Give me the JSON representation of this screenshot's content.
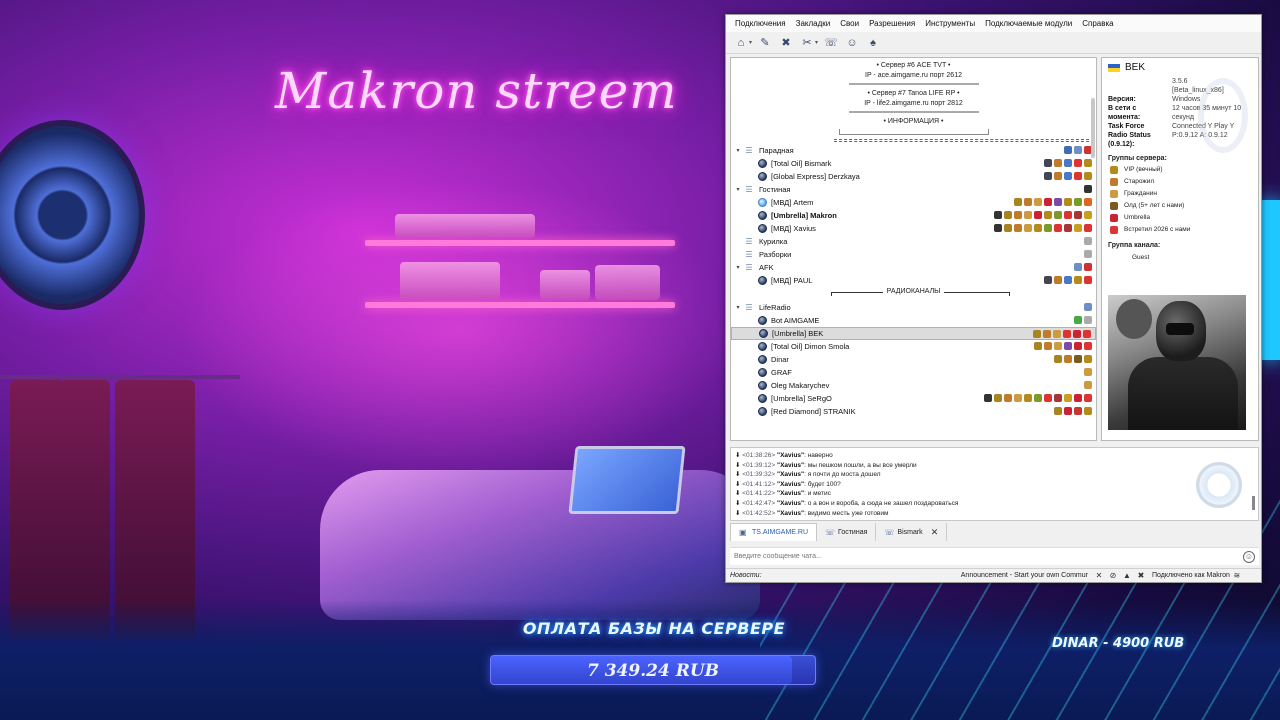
{
  "overlay": {
    "neon_sign": "Makron streem",
    "donate_title": "ОПЛАТА БАЗЫ НА СЕРВЕРЕ",
    "donate_amount": "7 349.24 RUB",
    "donate_progress": 0.93,
    "dinar_label": "DINAR - 4900 RUB"
  },
  "window": {
    "menu": [
      "Подключения",
      "Закладки",
      "Свои",
      "Разрешения",
      "Инструменты",
      "Подключаемые модули",
      "Справка"
    ],
    "toolbar": [
      {
        "icon": "connect-icon"
      },
      {
        "icon": "bookmark-icon"
      },
      {
        "icon": "away-icon"
      },
      {
        "icon": "mute-icon"
      },
      {
        "icon": "chat-icon"
      },
      {
        "icon": "contacts-icon"
      },
      {
        "icon": "whisper-icon"
      }
    ]
  },
  "tree": {
    "banner": {
      "server6": "• Сервер #6 ACE TVT •",
      "server6_ip": "IP - ace.aimgame.ru порт 2612",
      "server7": "• Сервер #7 Tanoa LIFE RP •",
      "server7_ip": "IP - life2.aimgame.ru порт 2812",
      "info": "• ИНФОРМАЦИЯ •"
    },
    "radio_separator": "РАДИОКАНАЛЫ",
    "rows": [
      {
        "type": "channel",
        "caret": "▾",
        "name": "Парадная",
        "badges": [
          "#3f6db3",
          "#6e8fc4",
          "#c33"
        ]
      },
      {
        "type": "client",
        "name": "[Total Oil] Bismark",
        "badges": [
          "#445",
          "#c07a2a",
          "#4a78c8",
          "#d33",
          "#b58a1c"
        ]
      },
      {
        "type": "client",
        "name": "[Global Express] Derzkaya",
        "badges": [
          "#445",
          "#c07a2a",
          "#4a78c8",
          "#d33",
          "#b58a1c"
        ]
      },
      {
        "type": "channel",
        "caret": "▾",
        "name": "Гостиная",
        "badges": [
          "#333"
        ]
      },
      {
        "type": "client",
        "talk": true,
        "name": "[МВД] Artem",
        "badges": [
          "#a88420",
          "#c07a2a",
          "#cc9a40",
          "#c23",
          "#7b4aa8",
          "#b58a1c",
          "#7a9a2a",
          "#d62"
        ]
      },
      {
        "type": "client",
        "bold": true,
        "name": "[Umbrella] Makron",
        "badges": [
          "#333",
          "#a88420",
          "#c07a2a",
          "#cc9a40",
          "#c23",
          "#b58a1c",
          "#7a9a2a",
          "#d33",
          "#a33",
          "#c8a020"
        ]
      },
      {
        "type": "client",
        "name": "[МВД] Xavius",
        "badges": [
          "#333",
          "#a88420",
          "#c07a2a",
          "#cc9a40",
          "#b58a1c",
          "#7a9a2a",
          "#d33",
          "#a33",
          "#c8a020",
          "#d33"
        ]
      },
      {
        "type": "channel",
        "caret": "",
        "name": "Курилка",
        "badges": [
          "#aaa"
        ]
      },
      {
        "type": "channel",
        "caret": "",
        "name": "Разборки",
        "badges": [
          "#aaa"
        ]
      },
      {
        "type": "channel",
        "caret": "▾",
        "name": "AFK",
        "badges": [
          "#6e8fc4",
          "#c33"
        ]
      },
      {
        "type": "client",
        "name": "[МВД] PAUL",
        "badges": [
          "#445",
          "#c07a2a",
          "#4a78c8",
          "#b58a1c",
          "#d33"
        ]
      },
      {
        "type": "separator"
      },
      {
        "type": "channel",
        "caret": "▾",
        "name": "LifeRadio",
        "badges": [
          "#6e8fc4"
        ]
      },
      {
        "type": "client",
        "name": "Bot AIMGAME",
        "badges": [
          "#4a4",
          "#aaa"
        ]
      },
      {
        "type": "client",
        "selected": true,
        "name": "[Umbrella] BEK",
        "badges": [
          "#a88420",
          "#c07a2a",
          "#cc9a40",
          "#d33",
          "#c23",
          "#d33"
        ]
      },
      {
        "type": "client",
        "name": "[Total Oil] Dimon Smola",
        "badges": [
          "#a88420",
          "#c07a2a",
          "#cc9a40",
          "#7b4aa8",
          "#c23",
          "#d33"
        ]
      },
      {
        "type": "client",
        "name": "Dinar",
        "badges": [
          "#a88420",
          "#c07a2a",
          "#7a5a20",
          "#b58a1c"
        ]
      },
      {
        "type": "client",
        "name": "GRAF",
        "badges": [
          "#cc9a40"
        ]
      },
      {
        "type": "client",
        "name": "Oleg Makarychev",
        "badges": [
          "#cc9a40"
        ]
      },
      {
        "type": "client",
        "name": "[Umbrella] SeRgO",
        "badges": [
          "#333",
          "#a88420",
          "#c07a2a",
          "#cc9a40",
          "#b58a1c",
          "#7a9a2a",
          "#d33",
          "#a33",
          "#c8a020",
          "#c23",
          "#d33"
        ]
      },
      {
        "type": "client",
        "name": "[Red Diamond] STRANIK",
        "badges": [
          "#a88420",
          "#c23",
          "#c33",
          "#b58a1c"
        ]
      }
    ]
  },
  "info": {
    "nickname": "BEK",
    "fields": [
      {
        "k": "",
        "v": "3.5.6"
      },
      {
        "k": "",
        "v": "[Beta_linux_x86]"
      },
      {
        "k": "Версия:",
        "v": "Windows"
      },
      {
        "k": "В сети с",
        "v": "12 часов 35 минут 10"
      },
      {
        "k": "момента:",
        "v": "секунд"
      },
      {
        "k": "",
        "v": ""
      },
      {
        "k": "Task Force",
        "v": "Connected Y Play Y"
      },
      {
        "k": "Radio Status",
        "v": "P:0.9.12 A: 0.9.12"
      },
      {
        "k": "(0.9.12):",
        "v": ""
      }
    ],
    "server_groups_title": "Группы сервера:",
    "server_groups": [
      {
        "label": "VIP (вечный)",
        "color": "#b58a1c"
      },
      {
        "label": "Старожил",
        "color": "#c07a2a"
      },
      {
        "label": "Гражданин",
        "color": "#cc9a40"
      },
      {
        "label": "Олд (5+ лет с нами)",
        "color": "#7a5a20"
      },
      {
        "label": "Umbrella",
        "color": "#c23"
      },
      {
        "label": "Встретил 2026 с нами",
        "color": "#d33"
      }
    ],
    "channel_group_title": "Группа канала:",
    "channel_group": "Guest"
  },
  "chat": {
    "messages": [
      {
        "t": "<01:38:26>",
        "u": "\"Xavius\"",
        "m": ": наверно"
      },
      {
        "t": "<01:39:12>",
        "u": "\"Xavius\"",
        "m": ": мы пешком пошли, а вы все умерли"
      },
      {
        "t": "<01:39:32>",
        "u": "\"Xavius\"",
        "m": ": я почти до моста дошел"
      },
      {
        "t": "<01:41:12>",
        "u": "\"Xavius\"",
        "m": ": будет 100?"
      },
      {
        "t": "<01:41:22>",
        "u": "\"Xavius\"",
        "m": ": и метис"
      },
      {
        "t": "<01:42:47>",
        "u": "\"Xavius\"",
        "m": ": о а вон и ворoба, а сюда не зашел поздароваться"
      },
      {
        "t": "<01:42:52>",
        "u": "\"Xavius\"",
        "m": ": видимо месть уже готовим"
      }
    ],
    "tabs": [
      {
        "label": "TS.AIMGAME.RU",
        "active": true,
        "closable": false
      },
      {
        "label": "Гостиная",
        "active": false,
        "closable": false
      },
      {
        "label": "Bismark",
        "active": false,
        "closable": true
      }
    ],
    "input_placeholder": "Введите сообщение чата..."
  },
  "status": {
    "news": "Новости:",
    "announcement": "Announcement - Start your own Commur",
    "connection": "Подключено как Makron"
  }
}
